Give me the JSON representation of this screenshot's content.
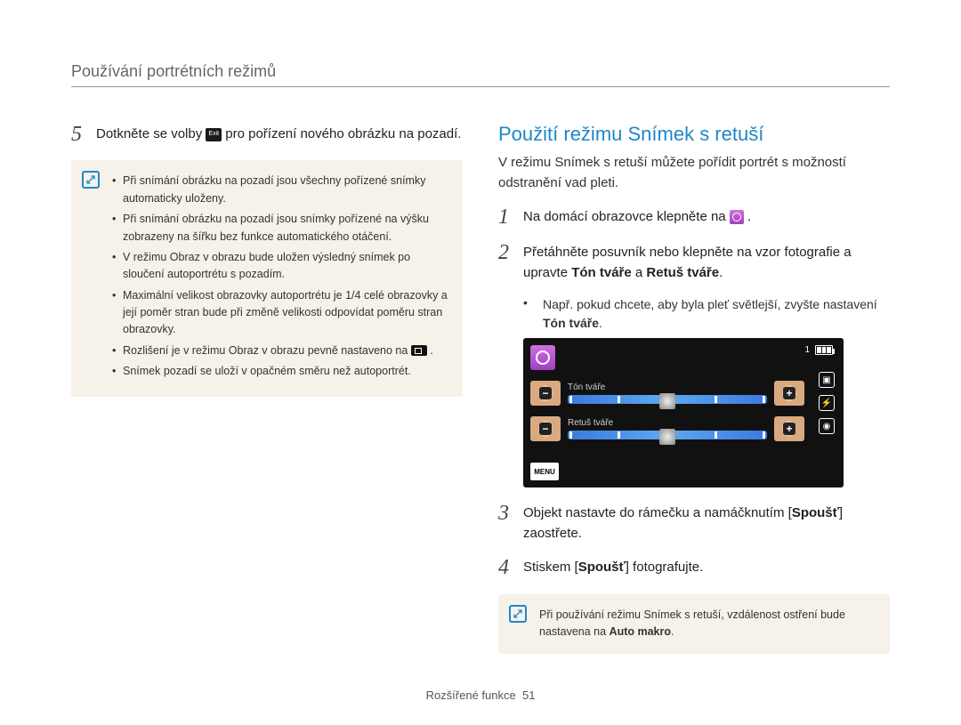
{
  "header": "Používání portrétních režimů",
  "left": {
    "step5_num": "5",
    "step5_pre": "Dotkněte se volby ",
    "step5_exit": "Exit",
    "step5_post": " pro pořízení nového obrázku na pozadí.",
    "note": {
      "b1": "Při snímání obrázku na pozadí jsou všechny pořízené snímky automaticky uloženy.",
      "b2": "Při snímání obrázku na pozadí jsou snímky pořízené na výšku zobrazeny na šířku bez funkce automatického otáčení.",
      "b3": "V režimu Obraz v obrazu bude uložen výsledný snímek po sloučení autoportrétu s pozadím.",
      "b4": "Maximální velikost obrazovky autoportrétu je 1/4 celé obrazovky a její poměr stran bude při změně velikosti odpovídat poměru stran obrazovky.",
      "b5_pre": "Rozlišení je v režimu Obraz v obrazu pevně nastaveno na ",
      "b5_post": ".",
      "b6": "Snímek pozadí se uloží v opačném směru než autoportrét."
    }
  },
  "right": {
    "section_title": "Použití režimu Snímek s retuší",
    "intro": "V režimu Snímek s retuší můžete pořídit portrét s možností odstranění vad pleti.",
    "step1_num": "1",
    "step1_pre": "Na domácí obrazovce klepněte na ",
    "step1_post": ".",
    "step2_num": "2",
    "step2_pre": "Přetáhněte posuvník nebo klepněte na vzor fotografie a upravte ",
    "step2_bold1": "Tón tváře",
    "step2_mid": " a ",
    "step2_bold2": "Retuš tváře",
    "step2_post": ".",
    "step2_sub_pre": "Např. pokud chcete, aby byla pleť světlejší, zvyšte nastavení ",
    "step2_sub_bold": "Tón tváře",
    "step2_sub_post": ".",
    "screen": {
      "counter": "1",
      "slider1_label": "Tón tváře",
      "slider2_label": "Retuš tváře",
      "menu": "MENU"
    },
    "step3_num": "3",
    "step3_pre": "Objekt nastavte do rámečku a namáčknutím [",
    "step3_bold": "Spoušť",
    "step3_post": "] zaostřete.",
    "step4_num": "4",
    "step4_pre": "Stiskem [",
    "step4_bold": "Spoušť",
    "step4_post": "] fotografujte.",
    "note2_pre": "Při používání režimu Snímek s retuší, vzdálenost ostření bude nastavena na ",
    "note2_bold": "Auto makro",
    "note2_post": "."
  },
  "footer_left": "Rozšířené funkce",
  "footer_page": "51"
}
